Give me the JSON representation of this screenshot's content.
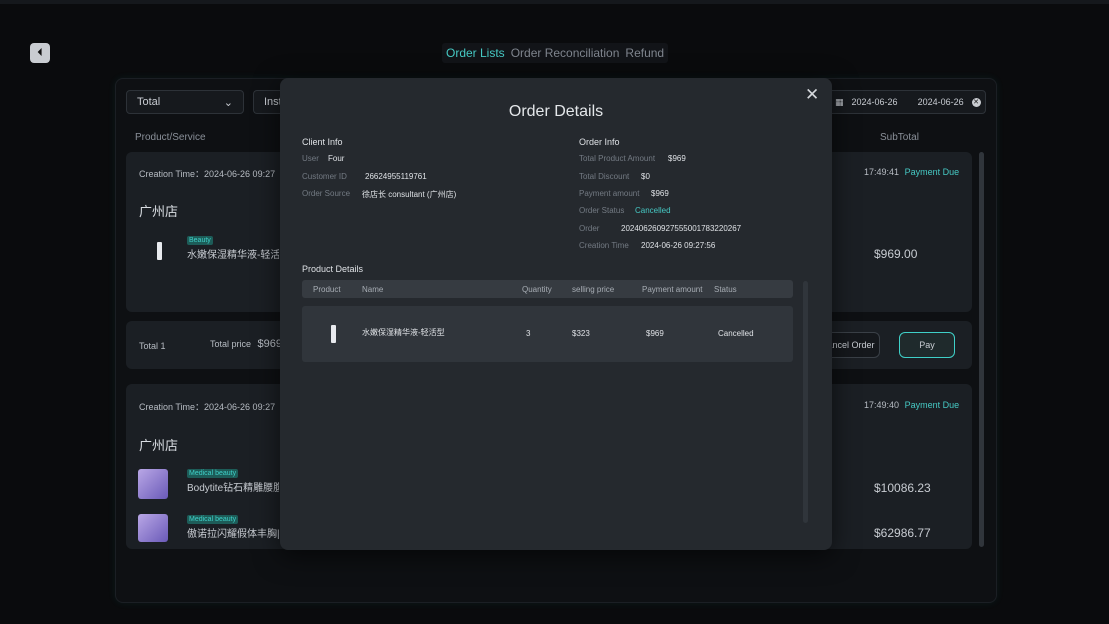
{
  "nav": {
    "back_icon": "⏴",
    "tabs": [
      "Order Lists",
      "Order Reconciliation",
      "Refund"
    ]
  },
  "filters": {
    "select1": "Total",
    "select2": "Inst",
    "date_from": "2024-06-26",
    "date_to": "2024-06-26"
  },
  "columns": {
    "product": "Product/Service",
    "subtotal": "SubTotal"
  },
  "orders": [
    {
      "creation": "Creation Time：2024-06-26 09:27",
      "time": "17:49:41",
      "status": "Payment Due",
      "store": "广州店",
      "tag": "Beauty",
      "product": "水嫩保湿精华液-轻活型",
      "subtotal": "$969.00",
      "total_label": "Total 1",
      "price_label": "Total price",
      "price_value": "$969",
      "cancel_btn": "ancel Order",
      "pay_btn": "Pay"
    },
    {
      "creation": "Creation Time：2024-06-26 09:27",
      "time": "17:49:40",
      "status": "Payment Due",
      "store": "广州店",
      "items": [
        {
          "tag": "Medical beauty",
          "product": "Bodytite钻石精雕腰腹|",
          "subtotal": "$10086.23"
        },
        {
          "tag": "Medical beauty",
          "product": "傲诺拉闪耀假体丰胸|",
          "subtotal": "$62986.77"
        }
      ]
    }
  ],
  "modal": {
    "title": "Order Details",
    "close": "✕",
    "client_info_title": "Client Info",
    "client": [
      {
        "label": "User",
        "value": "Four"
      },
      {
        "label": "Customer ID",
        "value": "26624955119761"
      },
      {
        "label": "Order Source",
        "value": "徐店长 consultant (广州店)"
      }
    ],
    "order_info_title": "Order Info",
    "order": [
      {
        "label": "Total Product Amount",
        "value": "$969"
      },
      {
        "label": "Total Discount",
        "value": "$0"
      },
      {
        "label": "Payment amount",
        "value": "$969"
      },
      {
        "label": "Order Status",
        "value": "Cancelled"
      },
      {
        "label": "Order",
        "value": "202406260927555001783220267"
      },
      {
        "label": "Creation Time",
        "value": "2024-06-26 09:27:56"
      }
    ],
    "product_details_title": "Product Details",
    "table_headers": [
      "Product",
      "Name",
      "Quantity",
      "selling price",
      "Payment amount",
      "Status"
    ],
    "table_row": {
      "name": "水嫩保湿精华液-轻活型",
      "quantity": "3",
      "price": "$323",
      "amount": "$969",
      "status": "Cancelled"
    }
  }
}
